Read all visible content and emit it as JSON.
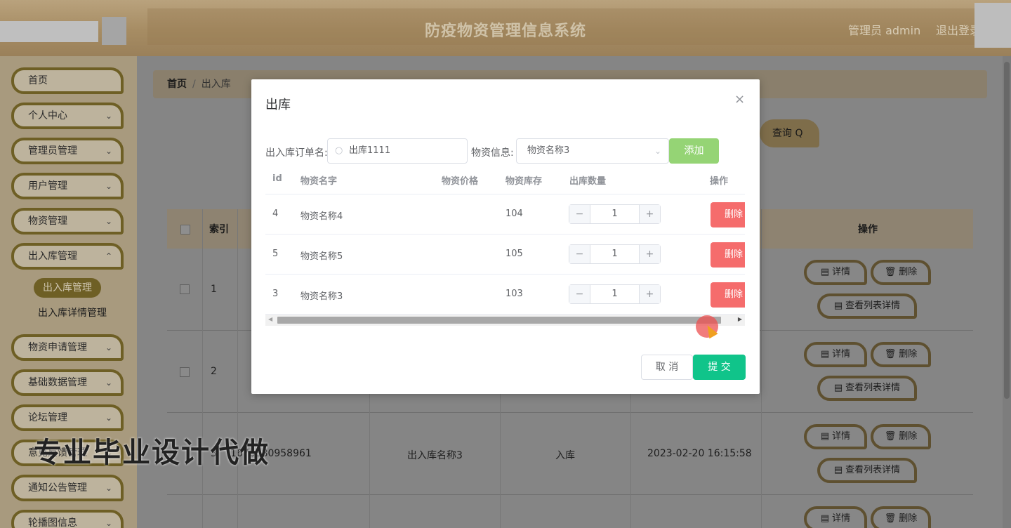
{
  "header": {
    "title": "防疫物资管理信息系统",
    "admin_label": "管理员 admin",
    "logout_label": "退出登录"
  },
  "sidebar": {
    "items": [
      {
        "label": "首页",
        "chevron": ""
      },
      {
        "label": "个人中心",
        "chevron": "⌄"
      },
      {
        "label": "管理员管理",
        "chevron": "⌄"
      },
      {
        "label": "用户管理",
        "chevron": "⌄"
      },
      {
        "label": "物资管理",
        "chevron": "⌄"
      },
      {
        "label": "出入库管理",
        "chevron": "⌃"
      },
      {
        "label": "物资申请管理",
        "chevron": "⌄"
      },
      {
        "label": "基础数据管理",
        "chevron": "⌄"
      },
      {
        "label": "论坛管理",
        "chevron": "⌄"
      },
      {
        "label": "意见反馈管理",
        "chevron": "⌄"
      },
      {
        "label": "通知公告管理",
        "chevron": "⌄"
      },
      {
        "label": "轮播图信息",
        "chevron": "⌄"
      }
    ],
    "sub_active": "出入库管理",
    "sub_item": "出入库详情管理"
  },
  "breadcrumb": {
    "home": "首页",
    "separator": "/",
    "current": "出入库"
  },
  "toolbar": {
    "query_label": "查询",
    "query_icon": "Q"
  },
  "table": {
    "header_index": "索引",
    "header_operation": "操作",
    "rows": [
      {
        "index": "1",
        "number": "",
        "name": "",
        "type": "",
        "time": ""
      },
      {
        "index": "2",
        "number": "",
        "name": "",
        "type": "",
        "time": ""
      },
      {
        "index": "3",
        "number": "1676880958961",
        "name": "出入库名称3",
        "type": "入库",
        "time": "2023-02-20 16:15:58"
      },
      {
        "index": "",
        "number": "",
        "name": "",
        "type": "",
        "time": ""
      }
    ],
    "op_detail": "详情",
    "op_delete": "删除",
    "op_list_detail": "查看列表详情"
  },
  "watermark": "专业毕业设计代做",
  "modal": {
    "title": "出库",
    "close_icon": "×",
    "order_label": "出入库订单名:",
    "order_value": "出库1111",
    "material_label": "物资信息:",
    "material_value": "物资名称3",
    "add_label": "添加",
    "columns": {
      "id": "id",
      "name": "物资名字",
      "price": "物资价格",
      "stock": "物资库存",
      "qty": "出库数量",
      "op": "操作"
    },
    "rows": [
      {
        "id": "4",
        "name": "物资名称4",
        "price": "",
        "stock": "104",
        "qty": "1"
      },
      {
        "id": "5",
        "name": "物资名称5",
        "price": "",
        "stock": "105",
        "qty": "1"
      },
      {
        "id": "3",
        "name": "物资名称3",
        "price": "",
        "stock": "103",
        "qty": "1"
      }
    ],
    "delete_label": "删除",
    "minus": "−",
    "plus": "+",
    "cancel_label": "取 消",
    "submit_label": "提 交"
  },
  "colors": {
    "accent_green": "#10c48a",
    "add_green": "#95d475",
    "danger_red": "#f56c6c",
    "brand_olive": "#6e5f25"
  }
}
